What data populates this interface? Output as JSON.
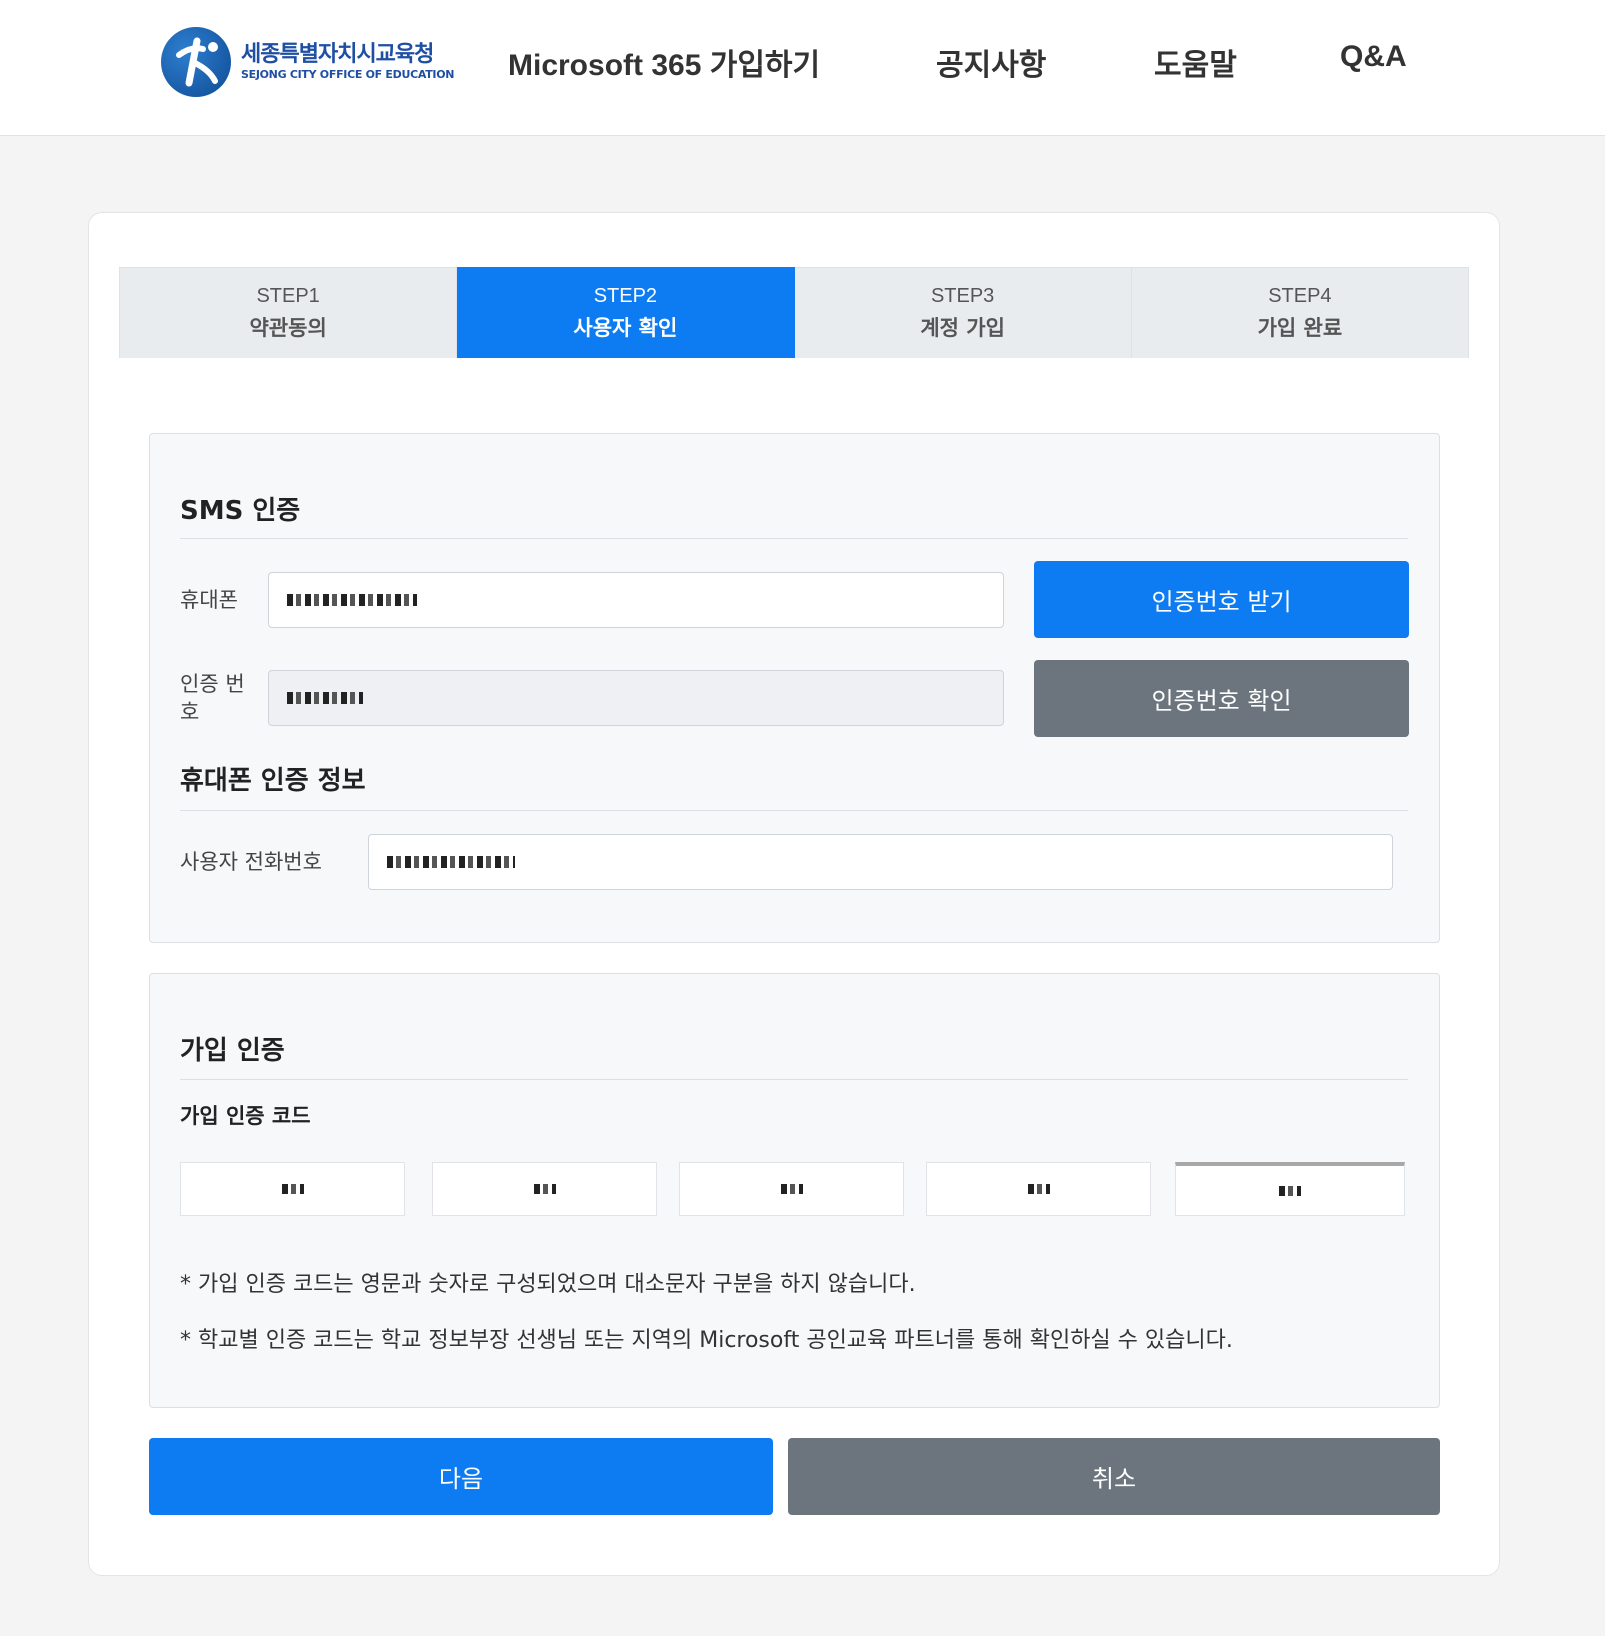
{
  "header": {
    "logo_ko": "세종특별자치시교육청",
    "logo_en": "SEJONG CITY OFFICE OF EDUCATION",
    "nav": [
      {
        "label": "Microsoft 365 가입하기"
      },
      {
        "label": "공지사항"
      },
      {
        "label": "도움말"
      },
      {
        "label": "Q&A"
      }
    ]
  },
  "steps": [
    {
      "num": "STEP1",
      "label": "약관동의",
      "active": false
    },
    {
      "num": "STEP2",
      "label": "사용자 확인",
      "active": true
    },
    {
      "num": "STEP3",
      "label": "계정 가입",
      "active": false
    },
    {
      "num": "STEP4",
      "label": "가입 완료",
      "active": false
    }
  ],
  "sms": {
    "title": "SMS 인증",
    "phone_label": "휴대폰",
    "code_label": "인증 번호",
    "send_button": "인증번호 받기",
    "verify_button": "인증번호 확인"
  },
  "phone_info": {
    "title": "휴대폰 인증 정보",
    "user_phone_label": "사용자 전화번호"
  },
  "join_auth": {
    "title": "가입 인증",
    "code_label": "가입 인증 코드",
    "notes": [
      "* 가입 인증 코드는 영문과 숫자로 구성되었으며 대소문자 구분을 하지 않습니다.",
      "* 학교별 인증 코드는 학교 정보부장 선생님 또는 지역의 Microsoft 공인교육 파트너를 통해 확인하실 수 있습니다."
    ]
  },
  "actions": {
    "next": "다음",
    "cancel": "취소"
  },
  "colors": {
    "primary": "#0d7cf2",
    "secondary": "#6c757d",
    "brand": "#1f4fa3"
  }
}
